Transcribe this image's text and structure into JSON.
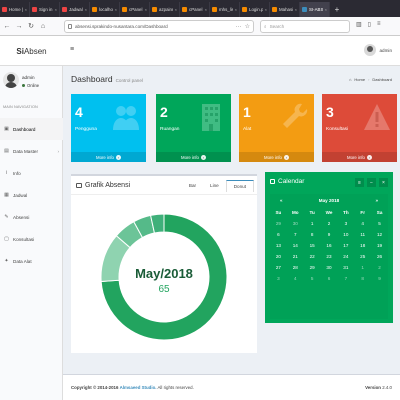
{
  "browser": {
    "tabs": [
      {
        "label": "Home | Ak",
        "color": "#e44"
      },
      {
        "label": "Sign in | Ak",
        "color": "#e44"
      },
      {
        "label": "Jadwal | S",
        "color": "#e44"
      },
      {
        "label": "localhost",
        "color": "#f58b00"
      },
      {
        "label": "cPanel - Ak",
        "color": "#f58b00"
      },
      {
        "label": "azpainngin",
        "color": "#f58b00"
      },
      {
        "label": "cPanel File",
        "color": "#f58b00"
      },
      {
        "label": "mhs_list.p",
        "color": "#f58b00"
      },
      {
        "label": "Login.php",
        "color": "#f58b00"
      },
      {
        "label": "Mahasisw",
        "color": "#f58b00"
      },
      {
        "label": "SI-ABSEN",
        "color": "#3c8dbc"
      }
    ],
    "new_tab": "+",
    "url": "absensi.sprakindo-nusantara.com/Dashboard",
    "search_placeholder": "Search",
    "nav": {
      "back": "←",
      "forward": "→",
      "reload": "↻",
      "home": "⌂",
      "menu_dots": "···",
      "star": "☆"
    }
  },
  "header": {
    "logo_bold": "Si",
    "logo_rest": "Absen",
    "hamburger": "≡",
    "user_name": "admin"
  },
  "sidebar": {
    "user_name": "admin",
    "status": "Online",
    "section_label": "MAIN NAVIGATION",
    "items": [
      {
        "label": "Dashboard",
        "icon": "▣"
      },
      {
        "label": "Data Master",
        "icon": "▤",
        "chevron": "›"
      },
      {
        "label": "Info",
        "icon": "i"
      },
      {
        "label": "Jadwal",
        "icon": "▦"
      },
      {
        "label": "Absensi",
        "icon": "✎"
      },
      {
        "label": "Konsultasi",
        "icon": "▢"
      },
      {
        "label": "Data Alat",
        "icon": "✦"
      }
    ]
  },
  "content": {
    "title": "Dashboard",
    "subtitle": "Control panel",
    "breadcrumb": [
      "Home",
      "Dashboard"
    ]
  },
  "stat_boxes": [
    {
      "number": "4",
      "label": "Pengguna",
      "more": "More info",
      "color": "#00c0ef",
      "icon": "users-icon"
    },
    {
      "number": "2",
      "label": "Ruangan",
      "more": "More info",
      "color": "#00a65a",
      "icon": "building-icon"
    },
    {
      "number": "1",
      "label": "Alat",
      "more": "More info",
      "color": "#f39c12",
      "icon": "wrench-icon"
    },
    {
      "number": "3",
      "label": "Konsultasi",
      "more": "More info",
      "color": "#dd4b39",
      "icon": "warning-icon"
    }
  ],
  "chart_panel": {
    "title": "Grafik Absensi",
    "tabs": [
      "Bar",
      "Line",
      "Donut"
    ],
    "active_tab": "Donut"
  },
  "chart_data": {
    "type": "pie",
    "center_label": "May/2018",
    "center_value": "65",
    "slices": [
      {
        "value": 65,
        "color": "#22a45f"
      },
      {
        "value": 11,
        "color": "#8fd3b0"
      },
      {
        "value": 5,
        "color": "#6cc498"
      },
      {
        "value": 4,
        "color": "#55ba89"
      },
      {
        "value": 3,
        "color": "#3fb07a"
      }
    ]
  },
  "calendar": {
    "title": "Calendar",
    "month": "May 2018",
    "prev": "«",
    "next": "»",
    "tool_icons": [
      "≡",
      "−",
      "×"
    ],
    "weekdays": [
      "Su",
      "Mo",
      "Tu",
      "We",
      "Th",
      "Fr",
      "Sa"
    ],
    "days": [
      {
        "d": "29",
        "muted": true
      },
      {
        "d": "30",
        "muted": true
      },
      {
        "d": "1"
      },
      {
        "d": "2"
      },
      {
        "d": "3"
      },
      {
        "d": "4"
      },
      {
        "d": "5"
      },
      {
        "d": "6"
      },
      {
        "d": "7"
      },
      {
        "d": "8"
      },
      {
        "d": "9"
      },
      {
        "d": "10"
      },
      {
        "d": "11"
      },
      {
        "d": "12"
      },
      {
        "d": "13"
      },
      {
        "d": "14"
      },
      {
        "d": "15"
      },
      {
        "d": "16"
      },
      {
        "d": "17"
      },
      {
        "d": "18"
      },
      {
        "d": "19"
      },
      {
        "d": "20"
      },
      {
        "d": "21"
      },
      {
        "d": "22"
      },
      {
        "d": "23"
      },
      {
        "d": "24"
      },
      {
        "d": "25"
      },
      {
        "d": "26"
      },
      {
        "d": "27"
      },
      {
        "d": "28"
      },
      {
        "d": "29"
      },
      {
        "d": "30"
      },
      {
        "d": "31"
      },
      {
        "d": "1",
        "muted": true
      },
      {
        "d": "2",
        "muted": true
      },
      {
        "d": "3",
        "muted": true
      },
      {
        "d": "4",
        "muted": true
      },
      {
        "d": "5",
        "muted": true
      },
      {
        "d": "6",
        "muted": true
      },
      {
        "d": "7",
        "muted": true
      },
      {
        "d": "8",
        "muted": true
      },
      {
        "d": "9",
        "muted": true
      }
    ]
  },
  "footer": {
    "copyright_bold": "Copyright © 2014-2016",
    "studio": "Almsaeed Studio.",
    "rights": "All rights reserved.",
    "version_label": "Version",
    "version": "2.4.0"
  }
}
